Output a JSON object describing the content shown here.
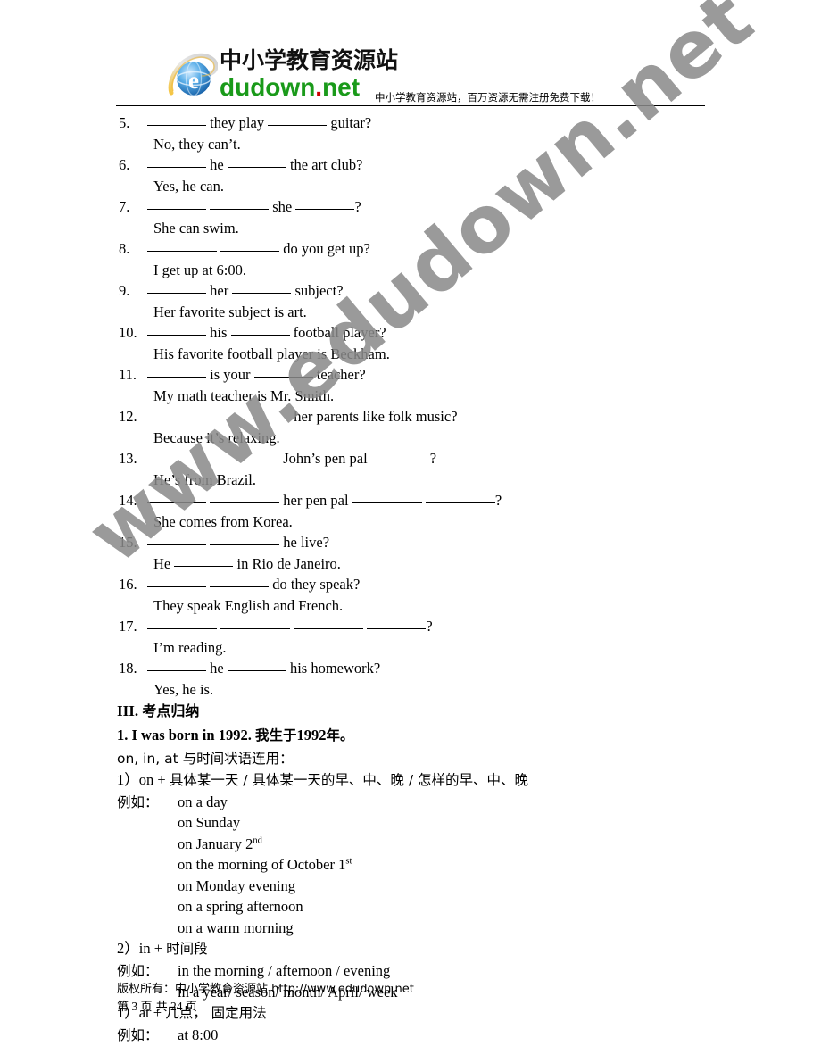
{
  "header": {
    "logo": {
      "icon": "internet-explorer-e-icon",
      "chinese_name": "中小学教育资源站",
      "latin_name_green": "dudown",
      "latin_name_dot": ".",
      "latin_name_red": "net"
    },
    "tagline": "中小学教育资源站，百万资源无需注册免费下载！"
  },
  "watermark": {
    "text": "www.edudown.net",
    "color": "#8a8a8a"
  },
  "exercises": [
    {
      "num": "5.",
      "question_parts": [
        "",
        " they play ",
        " guitar?"
      ],
      "blanks": [
        "b-m",
        "b-m"
      ],
      "answer": "No, they can’t."
    },
    {
      "num": "6.",
      "question_parts": [
        "",
        " he ",
        " the art club?"
      ],
      "blanks": [
        "b-m",
        "b-m"
      ],
      "answer": "Yes, he can."
    },
    {
      "num": "7.",
      "question_parts": [
        "",
        " ",
        " she ",
        "?"
      ],
      "blanks": [
        "b-m",
        "b-m",
        "b-m"
      ],
      "answer": "She can swim."
    },
    {
      "num": "8.",
      "question_parts": [
        "",
        " ",
        " do you get up?"
      ],
      "blanks": [
        "b-l",
        "b-m"
      ],
      "answer": "I get up at 6:00."
    },
    {
      "num": "9.",
      "question_parts": [
        "",
        " her ",
        " subject?"
      ],
      "blanks": [
        "b-m",
        "b-m"
      ],
      "answer": "Her favorite subject is art."
    },
    {
      "num": "10.",
      "question_parts": [
        "",
        " his ",
        " football player?"
      ],
      "blanks": [
        "b-m",
        "b-m"
      ],
      "answer": "His favorite football player is Beckham."
    },
    {
      "num": "11.",
      "question_parts": [
        "",
        " is your ",
        " teacher?"
      ],
      "blanks": [
        "b-m",
        "b-m"
      ],
      "answer": "My math teacher is Mr. Smith."
    },
    {
      "num": "12.",
      "question_parts": [
        "",
        " ",
        " her parents like folk music?"
      ],
      "blanks": [
        "b-l",
        "b-l"
      ],
      "answer": "Because it’s relaxing."
    },
    {
      "num": "13.",
      "question_parts": [
        "",
        " ",
        " John’s pen pal ",
        "?"
      ],
      "blanks": [
        "b-m",
        "b-l",
        "b-m"
      ],
      "answer": "He’s from Brazil."
    },
    {
      "num": "14.",
      "question_parts": [
        "",
        " ",
        " her pen pal ",
        " ",
        "?"
      ],
      "blanks": [
        "b-m",
        "b-l",
        "b-l",
        "b-l"
      ],
      "answer": "She comes from Korea."
    },
    {
      "num": "15.",
      "question_parts": [
        "",
        " ",
        " he live?"
      ],
      "blanks": [
        "b-m",
        "b-l"
      ],
      "answer": ""
    },
    {
      "num": "16.",
      "question_parts": [
        "",
        " ",
        " do they speak?"
      ],
      "blanks": [
        "b-m",
        "b-m"
      ],
      "answer": "They speak English and French."
    },
    {
      "num": "17.",
      "question_parts": [
        "",
        " ",
        " ",
        " ",
        "?"
      ],
      "blanks": [
        "b-l",
        "b-l",
        "b-l",
        "b-m"
      ],
      "answer": "I’m reading."
    },
    {
      "num": "18.",
      "question_parts": [
        "",
        " he ",
        " his homework?"
      ],
      "blanks": [
        "b-m",
        "b-m"
      ],
      "answer": "Yes, he is."
    }
  ],
  "item15_answer": {
    "prefix": "He ",
    "suffix": " in Rio de Janeiro."
  },
  "section": {
    "heading_numeral": "III.",
    "heading_title": "考点归纳",
    "point1_en": "1. I was born in 1992.",
    "point1_cn": "我生于",
    "point1_year": "1992",
    "point1_cn_tail": "年。",
    "intro": "on, in, at 与时间状语连用：",
    "rules": [
      {
        "label": "1）on +",
        "desc": "具体某一天 / 具体某一天的早、中、晚 / 怎样的早、中、晚",
        "example_label": "例如：",
        "examples": [
          "on a day",
          "on Sunday",
          "on January 2nd",
          "on the morning of October 1st",
          "on Monday evening",
          "on a spring afternoon",
          "on a warm morning"
        ]
      },
      {
        "label": "2）in +",
        "desc": "时间段",
        "example_label": "例如：",
        "examples": [
          "in the morning / afternoon / evening",
          "in a year/ season/ month/ April/ week"
        ]
      },
      {
        "label": "1）at +",
        "desc": "几点， 固定用法",
        "example_label": "例如：",
        "examples": [
          "at 8:00"
        ]
      }
    ]
  },
  "footer": {
    "copyright": "版权所有：中小学教育资源站 http://www.edudown.net",
    "page_prefix": "第",
    "page_number": "3",
    "page_middle": "页 共",
    "page_total": "24",
    "page_suffix": "页"
  }
}
